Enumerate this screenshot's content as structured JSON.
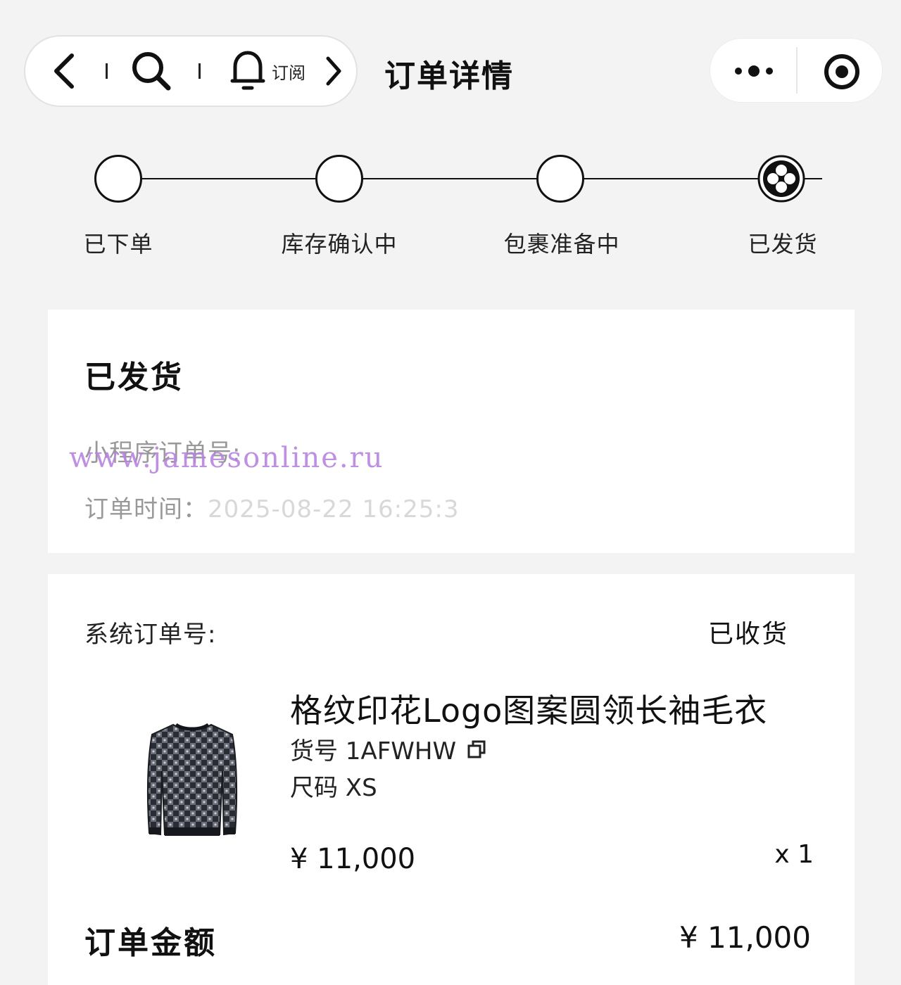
{
  "nav": {
    "subscribe_label": "订阅",
    "title": "订单详情"
  },
  "progress": {
    "steps": [
      {
        "label": "已下单"
      },
      {
        "label": "库存确认中"
      },
      {
        "label": "包裹准备中"
      },
      {
        "label": "已发货"
      }
    ],
    "current_index": 3
  },
  "shipment": {
    "status": "已发货",
    "mini_order_label": "小程序订单号:",
    "order_time_label": "订单时间：",
    "order_time_value": "2025-08-22 16:25:3"
  },
  "watermark": "www.jamesonline.ru",
  "order": {
    "system_order_label": "系统订单号:",
    "status": "已收货",
    "product": {
      "name": "格纹印花Logo图案圆领长袖毛衣",
      "sku_text": "货号 1AFWHW",
      "size_text": "尺码 XS",
      "price": "¥ 11,000",
      "quantity": "x 1"
    },
    "total_label": "订单金额",
    "total_value": "¥ 11,000"
  },
  "colors": {
    "background": "#f3f3f3",
    "card": "#ffffff",
    "text": "#111111",
    "muted": "#999999",
    "watermark": "#b883e0"
  }
}
